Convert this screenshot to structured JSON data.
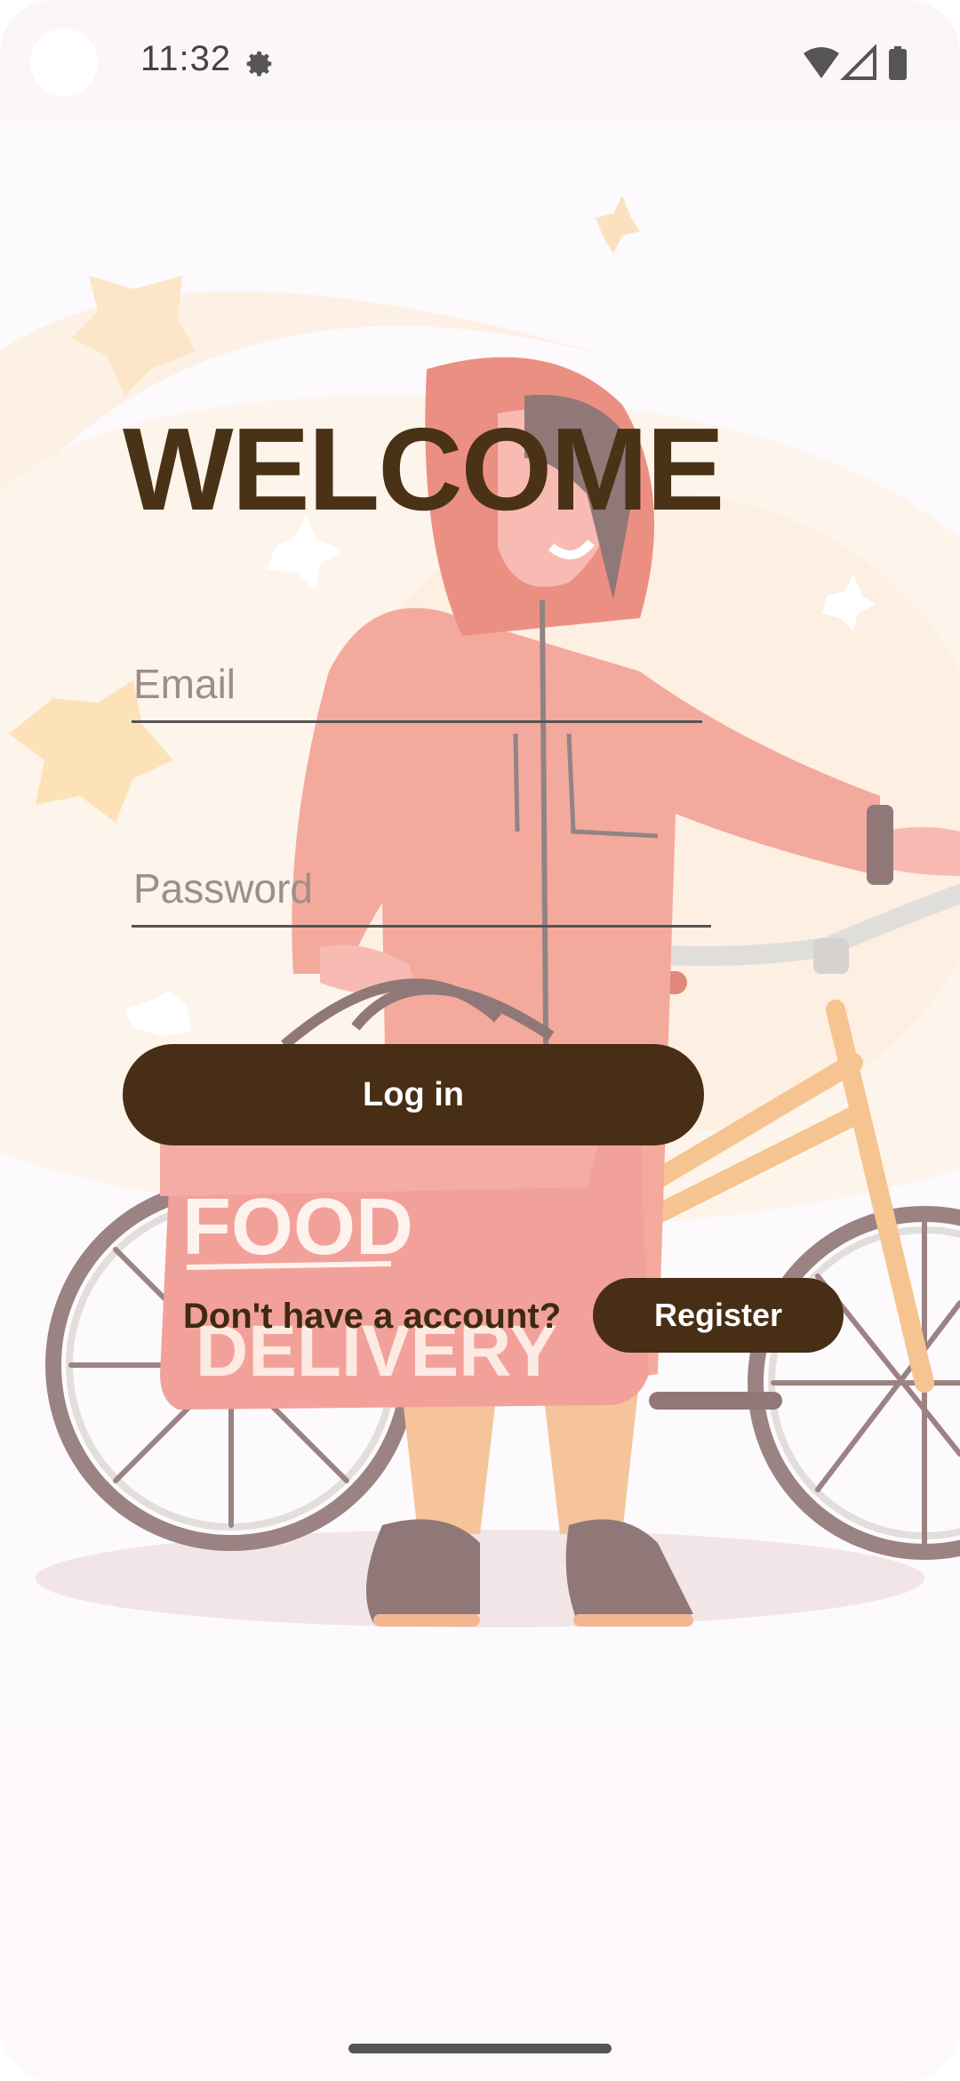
{
  "status_bar": {
    "time": "11:32",
    "icons": [
      "settings-gear-icon",
      "wifi-icon",
      "cellular-signal-icon",
      "battery-icon"
    ]
  },
  "login": {
    "title": "WELCOME",
    "email_placeholder": "Email",
    "email_value": "",
    "password_placeholder": "Password",
    "password_value": "",
    "login_label": "Log in",
    "no_account_text": "Don't have a account?",
    "register_label": "Register"
  },
  "illustration": {
    "box_text_line1": "FOOD",
    "box_text_line2": "DELIVERY"
  },
  "colors": {
    "primary": "#472e15",
    "title": "#4a3216",
    "background": "#fdf8fc"
  }
}
